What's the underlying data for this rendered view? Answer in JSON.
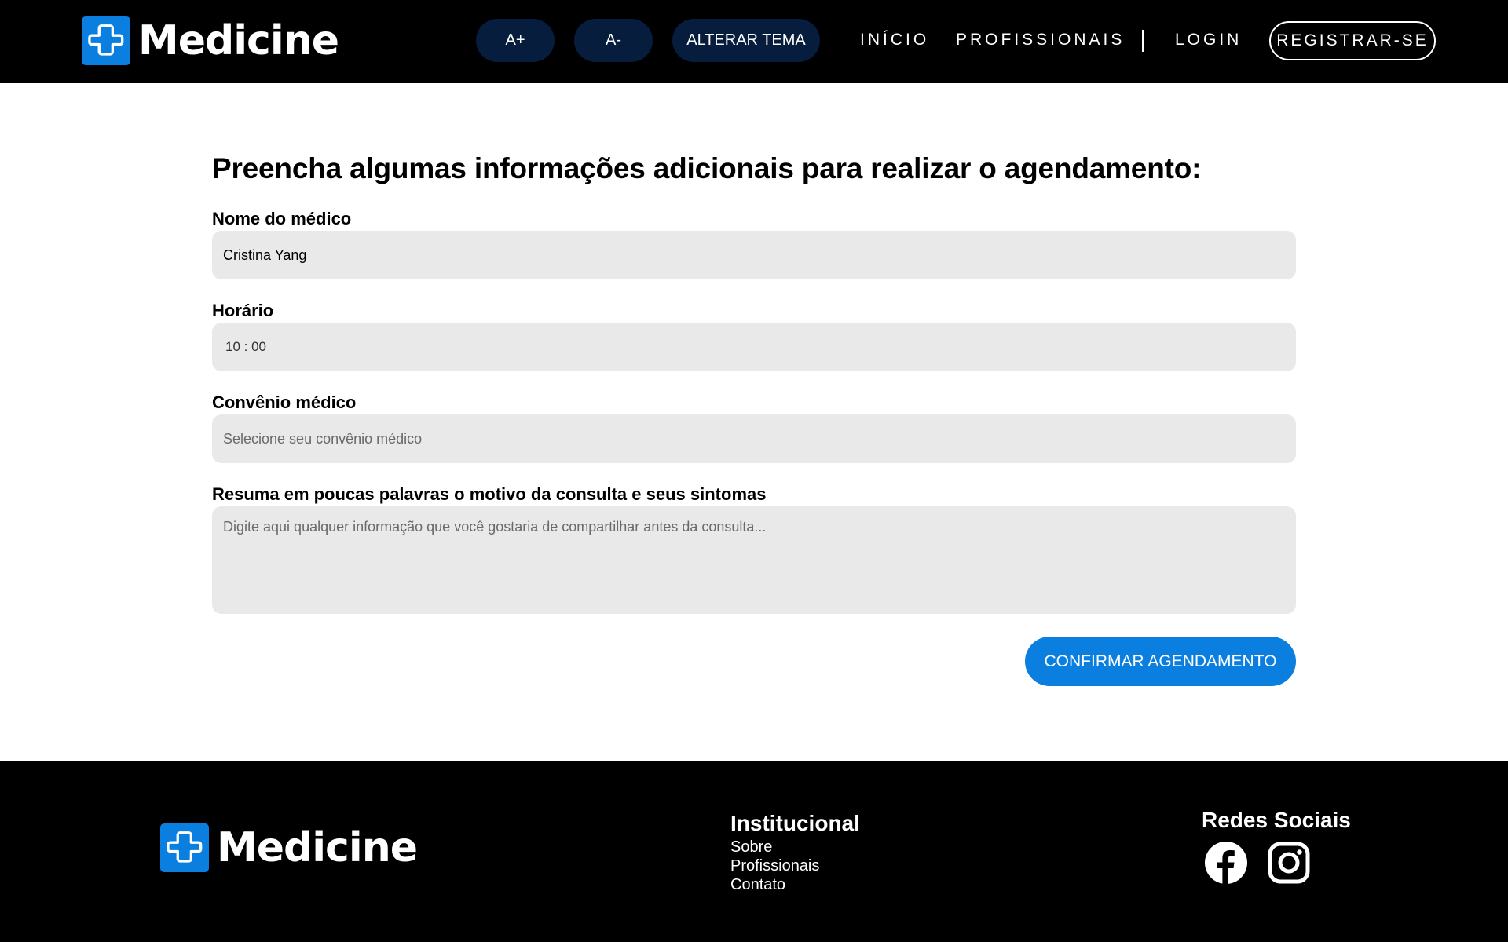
{
  "brand": {
    "name": "Medicine",
    "accent_color": "#0a7fe0"
  },
  "header": {
    "font_increase_label": "A+",
    "font_decrease_label": "A-",
    "theme_label": "ALTERAR TEMA",
    "nav": {
      "home": "INÍCIO",
      "professionals": "PROFISSIONAIS",
      "login": "LOGIN",
      "register": "REGISTRAR-SE"
    }
  },
  "form": {
    "title": "Preencha algumas informações adicionais para realizar o agendamento:",
    "doctor": {
      "label": "Nome do médico",
      "value": "Cristina Yang"
    },
    "time": {
      "label": "Horário",
      "value": "10 : 00"
    },
    "insurance": {
      "label": "Convênio médico",
      "placeholder": "Selecione seu convênio médico"
    },
    "reason": {
      "label": "Resuma em poucas palavras o motivo da consulta e seus sintomas",
      "placeholder": "Digite aqui qualquer informação que você gostaria de compartilhar antes da consulta..."
    },
    "submit_label": "CONFIRMAR AGENDAMENTO"
  },
  "footer": {
    "institutional": {
      "title": "Institucional",
      "links": [
        "Sobre",
        "Profissionais",
        "Contato"
      ]
    },
    "social": {
      "title": "Redes Sociais",
      "icons": [
        "facebook-icon",
        "instagram-icon"
      ]
    }
  }
}
